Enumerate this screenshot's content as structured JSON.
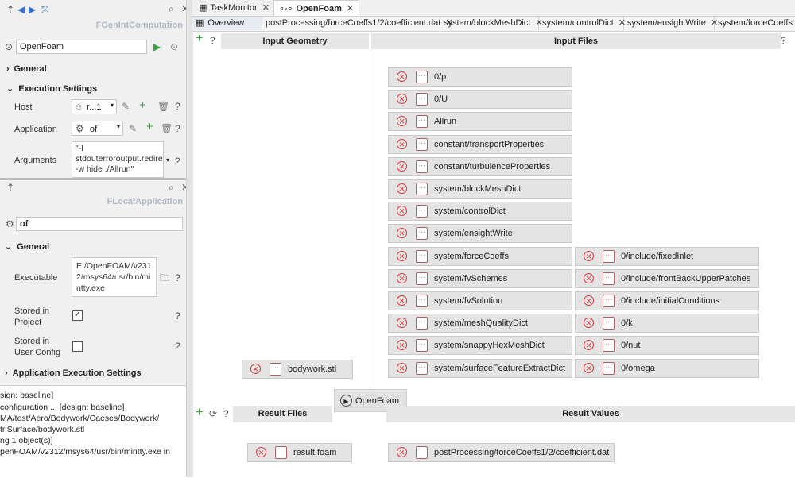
{
  "left_top": {
    "title": "FGenIntComputation",
    "name_value": "OpenFoam",
    "general_label": "General",
    "execution_label": "Execution Settings",
    "host_label": "Host",
    "host_value": "r...1",
    "application_label": "Application",
    "application_value": "of",
    "arguments_label": "Arguments",
    "arguments_value": "\"-l stdouterroroutput.redirect -w hide ./Allrun\""
  },
  "left_mid": {
    "title": "FLocalApplication",
    "name_value": "of",
    "general_label": "General",
    "executable_label": "Executable",
    "executable_value": "E:/OpenFOAM/v2312/msys64/usr/bin/mintty.exe",
    "stored_project_label": "Stored in Project",
    "stored_user_label": "Stored in User Config",
    "app_exec_label": "Application Execution Settings"
  },
  "log_lines": [
    "sign: baseline]",
    "configuration ... [design: baseline]",
    "MA/test/Aero/Bodywork/Caeses/Bodywork/",
    "triSurface/bodywork.stl",
    "ng 1 object(s)]",
    "penFOAM/v2312/msys64/usr/bin/mintty.exe in"
  ],
  "top_tabs": [
    "TaskMonitor",
    "OpenFoam"
  ],
  "sub_tabs": [
    "Overview",
    "postProcessing/forceCoeffs1/2/coefficient.dat",
    "system/blockMeshDict",
    "system/controlDict",
    "system/ensightWrite",
    "system/forceCoeffs"
  ],
  "input_geometry_label": "Input Geometry",
  "input_files_label": "Input Files",
  "geometry_files": [
    "bodywork.stl"
  ],
  "input_files_col1": [
    "0/p",
    "0/U",
    "Allrun",
    "constant/transportProperties",
    "constant/turbulenceProperties",
    "system/blockMeshDict",
    "system/controlDict",
    "system/ensightWrite",
    "system/forceCoeffs",
    "system/fvSchemes",
    "system/fvSolution",
    "system/meshQualityDict",
    "system/snappyHexMeshDict",
    "system/surfaceFeatureExtractDict"
  ],
  "input_files_col2": [
    "0/include/fixedInlet",
    "0/include/frontBackUpperPatches",
    "0/include/initialConditions",
    "0/k",
    "0/nut",
    "0/omega"
  ],
  "run_button_label": "OpenFoam",
  "result_files_label": "Result Files",
  "result_values_label": "Result Values",
  "result_files": [
    "result.foam"
  ],
  "result_values": [
    "postProcessing/forceCoeffs1/2/coefficient.dat"
  ],
  "icons": [
    "search-icon",
    "close-icon",
    "add-icon",
    "help-icon",
    "play-icon",
    "edit-icon",
    "delete-icon",
    "gear-icon",
    "folder-icon",
    "checkbox",
    "refresh-icon",
    "remove-icon"
  ]
}
